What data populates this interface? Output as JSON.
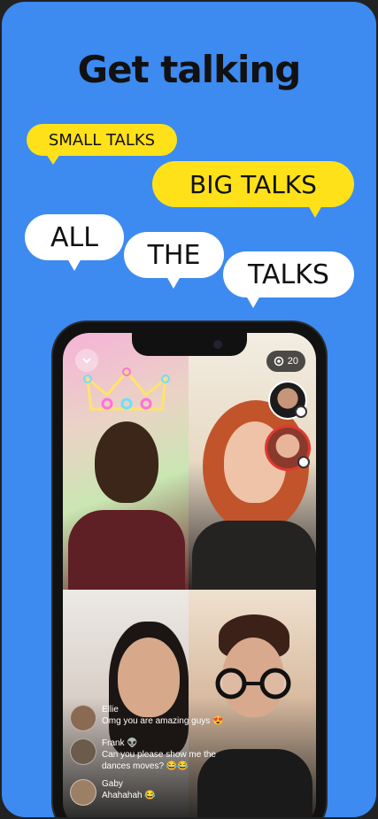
{
  "headline": "Get talking",
  "bubbles": {
    "small": "SMALL TALKS",
    "big": "BIG TALKS",
    "all": "ALL",
    "the": "THE",
    "talks": "TALKS"
  },
  "call": {
    "participant_count": "20",
    "chat": [
      {
        "name": "Ellie",
        "message": "Omg you are amazing guys 😍"
      },
      {
        "name": "Frank 👽",
        "message": "Can you please show me the dances moves? 😂😂"
      },
      {
        "name": "Gaby",
        "message": "Ahahahah 😂"
      }
    ]
  },
  "colors": {
    "background": "#3d8af0",
    "bubble_yellow": "#ffe11a",
    "bubble_white": "#ffffff",
    "crown_neon": "#ffe36b"
  },
  "icons": [
    "chevron-down-icon",
    "eye-icon",
    "crown-filter-icon"
  ]
}
